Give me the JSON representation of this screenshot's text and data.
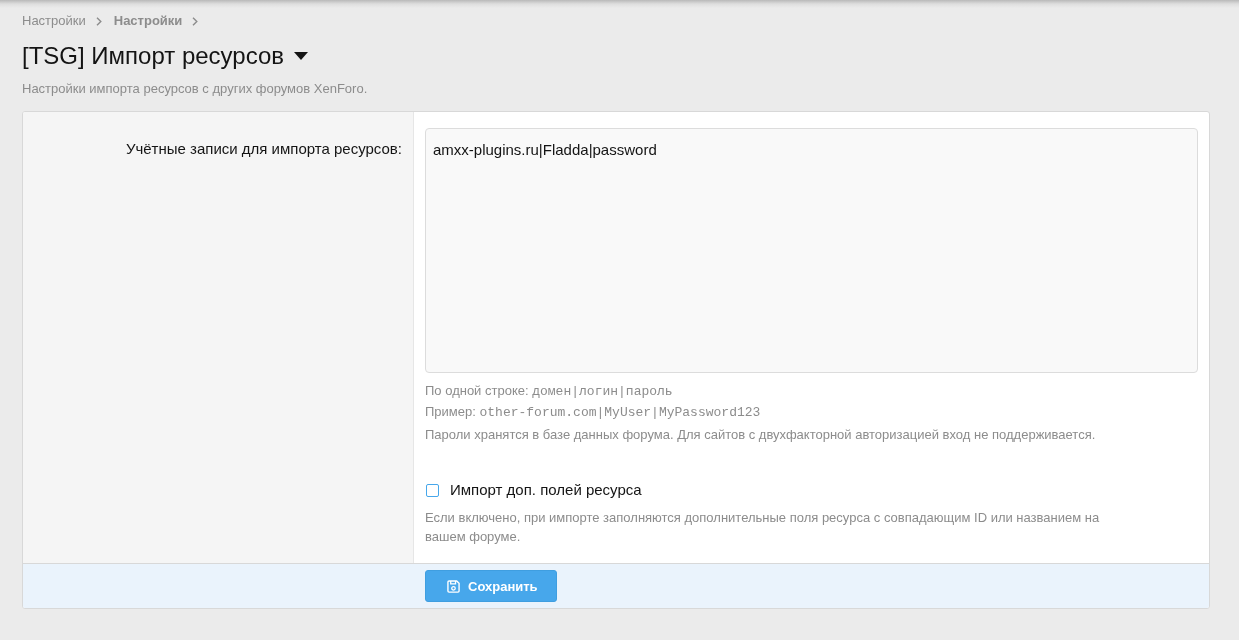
{
  "breadcrumbs": [
    {
      "label": "Настройки",
      "current": false
    },
    {
      "label": "Настройки",
      "current": true
    }
  ],
  "page": {
    "title": "[TSG] Импорт ресурсов",
    "description": "Настройки импорта ресурсов с других форумов XenForo."
  },
  "form": {
    "accounts": {
      "label": "Учётные записи для импорта ресурсов:",
      "value": "amxx-plugins.ru|Fladda|password",
      "hints": [
        {
          "text": "По одной строке:",
          "code": "домен|логин|пароль"
        },
        {
          "text": "Пример:",
          "code": "other-forum.com|MyUser|MyPassword123"
        },
        {
          "text": "Пароли хранятся в базе данных форума. Для сайтов с двухфакторной авторизацией вход не поддерживается."
        }
      ]
    },
    "import_fields": {
      "label": "Импорт доп. полей ресурса",
      "checked": false,
      "hint": "Если включено, при импорте заполняются дополнительные поля ресурса с совпадающим ID или названием на вашем форуме."
    },
    "save_button": "Сохранить"
  }
}
